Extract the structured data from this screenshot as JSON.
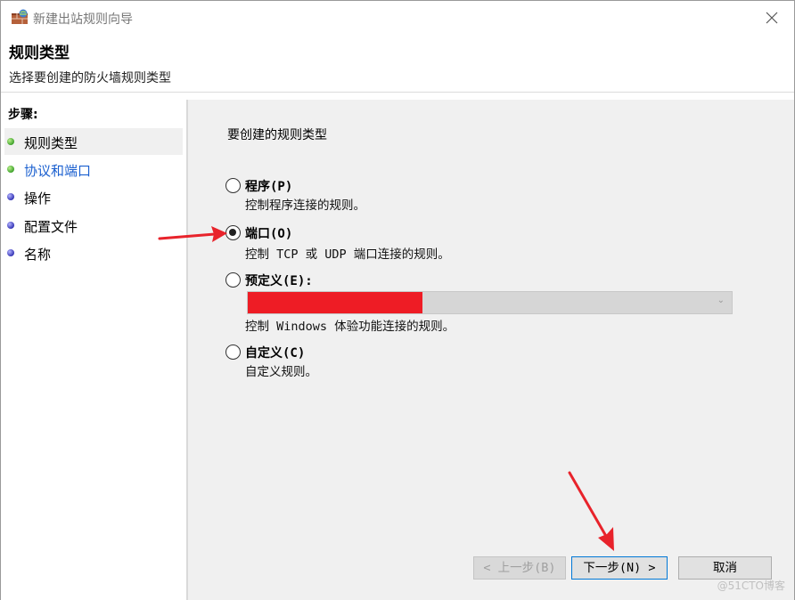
{
  "window": {
    "title": "新建出站规则向导",
    "icon": "firewall-icon"
  },
  "header": {
    "title": "规则类型",
    "subtitle": "选择要创建的防火墙规则类型"
  },
  "sidebar": {
    "label": "步骤:",
    "items": [
      {
        "label": "规则类型",
        "status": "green"
      },
      {
        "label": "协议和端口",
        "status": "green"
      },
      {
        "label": "操作",
        "status": "blue"
      },
      {
        "label": "配置文件",
        "status": "blue"
      },
      {
        "label": "名称",
        "status": "blue"
      }
    ]
  },
  "main": {
    "question": "要创建的规则类型",
    "options": [
      {
        "title": "程序(P)",
        "desc": "控制程序连接的规则。",
        "checked": false
      },
      {
        "title": "端口(O)",
        "desc": "控制 TCP 或 UDP 端口连接的规则。",
        "checked": true
      },
      {
        "title": "预定义(E):",
        "desc": "控制 Windows 体验功能连接的规则。",
        "checked": false
      },
      {
        "title": "自定义(C)",
        "desc": "自定义规则。",
        "checked": false
      }
    ],
    "predefined_dropdown": {
      "value": ""
    }
  },
  "buttons": {
    "back": "< 上一步(B)",
    "next": "下一步(N) >",
    "cancel": "取消"
  },
  "watermark": "@51CTO博客",
  "colors": {
    "annotation_arrow": "#e8232b",
    "redaction": "#ee1c25",
    "link": "#1a5fcf"
  }
}
